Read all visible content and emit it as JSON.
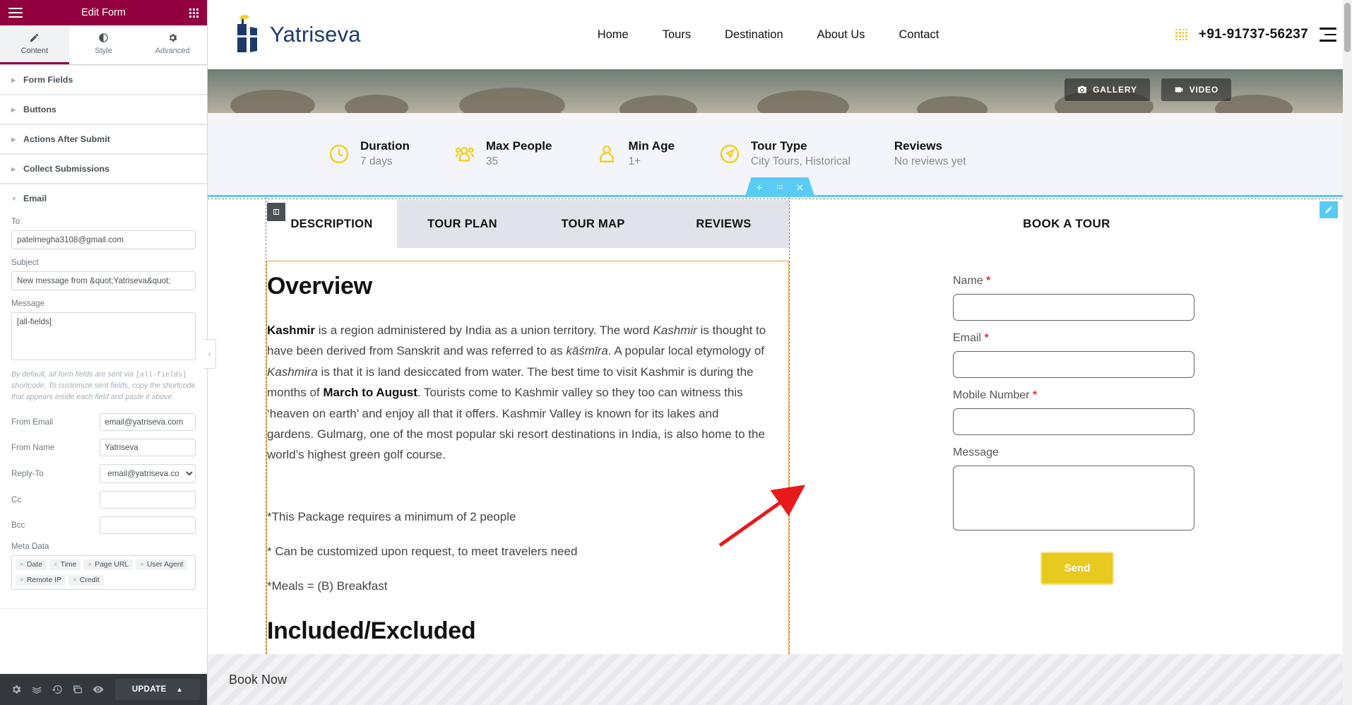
{
  "editor": {
    "header": {
      "title": "Edit Form",
      "menu_icon": "hamburger-icon",
      "apps_icon": "grid-apps-icon"
    },
    "tabs": [
      {
        "label": "Content",
        "icon": "pencil-icon",
        "active": true
      },
      {
        "label": "Style",
        "icon": "contrast-circle-icon",
        "active": false
      },
      {
        "label": "Advanced",
        "icon": "gear-icon",
        "active": false
      }
    ],
    "sections": [
      {
        "label": "Form Fields",
        "open": false
      },
      {
        "label": "Buttons",
        "open": false
      },
      {
        "label": "Actions After Submit",
        "open": false
      },
      {
        "label": "Collect Submissions",
        "open": false
      },
      {
        "label": "Email",
        "open": true
      }
    ],
    "email": {
      "to_label": "To",
      "to_value": "patelmegha3108@gmail.com",
      "subject_label": "Subject",
      "subject_value": "New message from &quot;Yatriseva&quot;",
      "message_label": "Message",
      "message_value": "[all-fields]",
      "message_desc_1": "By default, all form fields are sent via ",
      "message_desc_code": "[all-fields]",
      "message_desc_2": " shortcode. To customize sent fields, copy the shortcode that appears inside each field and paste it above.",
      "from_email_label": "From Email",
      "from_email_value": "email@yatriseva.com",
      "from_name_label": "From Name",
      "from_name_value": "Yatriseva",
      "reply_to_label": "Reply-To",
      "reply_to_value": "email@yatriseva.com",
      "cc_label": "Cc",
      "cc_value": "",
      "bcc_label": "Bcc",
      "bcc_value": "",
      "meta_data_label": "Meta Data",
      "meta_tags": [
        "Date",
        "Time",
        "Page URL",
        "User Agent",
        "Remote IP",
        "Credit"
      ]
    },
    "footer": {
      "settings_icon": "gear-icon",
      "navigator_icon": "layers-icon",
      "history_icon": "history-clock-icon",
      "responsive_icon": "responsive-devices-icon",
      "preview_icon": "eye-icon",
      "update_label": "UPDATE",
      "update_caret": "▲"
    },
    "panel_collapse_icon": "chevron-left-icon",
    "accent_color": "#93003f"
  },
  "site": {
    "logo_text": "Yatriseva",
    "nav": [
      "Home",
      "Tours",
      "Destination",
      "About Us",
      "Contact"
    ],
    "phone": "+91-91737-56237",
    "dots_icon": "dot-grid-icon",
    "menu_icon": "hamburger-icon",
    "hero_buttons": [
      {
        "label": "GALLERY",
        "icon": "camera-icon"
      },
      {
        "label": "VIDEO",
        "icon": "video-icon"
      }
    ],
    "meta": [
      {
        "icon": "clock-icon",
        "title": "Duration",
        "value": "7 days"
      },
      {
        "icon": "people-icon",
        "title": "Max People",
        "value": "35"
      },
      {
        "icon": "person-icon",
        "title": "Min Age",
        "value": "1+"
      },
      {
        "icon": "compass-send-icon",
        "title": "Tour Type",
        "value": "City Tours, Historical"
      },
      {
        "icon": "",
        "title": "Reviews",
        "value": "No reviews yet"
      }
    ],
    "tabs": [
      {
        "label": "DESCRIPTION",
        "active": true
      },
      {
        "label": "TOUR PLAN",
        "active": false
      },
      {
        "label": "TOUR MAP",
        "active": false
      },
      {
        "label": "REVIEWS",
        "active": false
      }
    ],
    "description": {
      "heading": "Overview",
      "para_lead": "Kashmir",
      "para_rest_1": " is a region administered by India as a union territory. The word ",
      "para_em_1": "Kashmir",
      "para_rest_2": " is thought to have been derived from Sanskrit and was referred to as ",
      "para_em_2": "kāśmīra",
      "para_rest_3": ". A popular local etymology of ",
      "para_em_3": "Kashmira",
      "para_rest_4": " is that it is land desiccated from water. The best time to visit Kashmir is during the months of ",
      "para_bold_1": "March to August",
      "para_rest_5": ". Tourists come to Kashmir valley so they too can witness this ‘heaven on earth’ and enjoy all that it offers. Kashmir Valley is known for its lakes and gardens. Gulmarg, one of the most popular ski resort destinations in India, is also home to the world’s highest green golf course.",
      "notes": [
        "*This Package requires a minimum of 2 people",
        "* Can be customized upon request, to meet travelers need",
        "*Meals = (B) Breakfast"
      ],
      "next_heading": "Included/Excluded"
    },
    "book_form": {
      "title": "BOOK A TOUR",
      "fields": [
        {
          "label": "Name",
          "required": true,
          "type": "text",
          "value": ""
        },
        {
          "label": "Email",
          "required": true,
          "type": "text",
          "value": ""
        },
        {
          "label": "Mobile Number",
          "required": true,
          "type": "text",
          "value": ""
        },
        {
          "label": "Message",
          "required": false,
          "type": "textarea",
          "value": ""
        }
      ],
      "submit_label": "Send",
      "submit_color": "#e8c91f"
    },
    "book_now_label": "Book Now"
  },
  "overlay": {
    "section_handle": {
      "add_icon": "plus-icon",
      "drag_icon": "drag-dots-icon",
      "close_icon": "close-x-icon",
      "color": "#59cbf5"
    },
    "widget_handle_icon": "columns-icon",
    "edit_pencil_icon": "pencil-icon",
    "annotation": {
      "type": "red-arrow",
      "color": "#e8191a"
    }
  }
}
